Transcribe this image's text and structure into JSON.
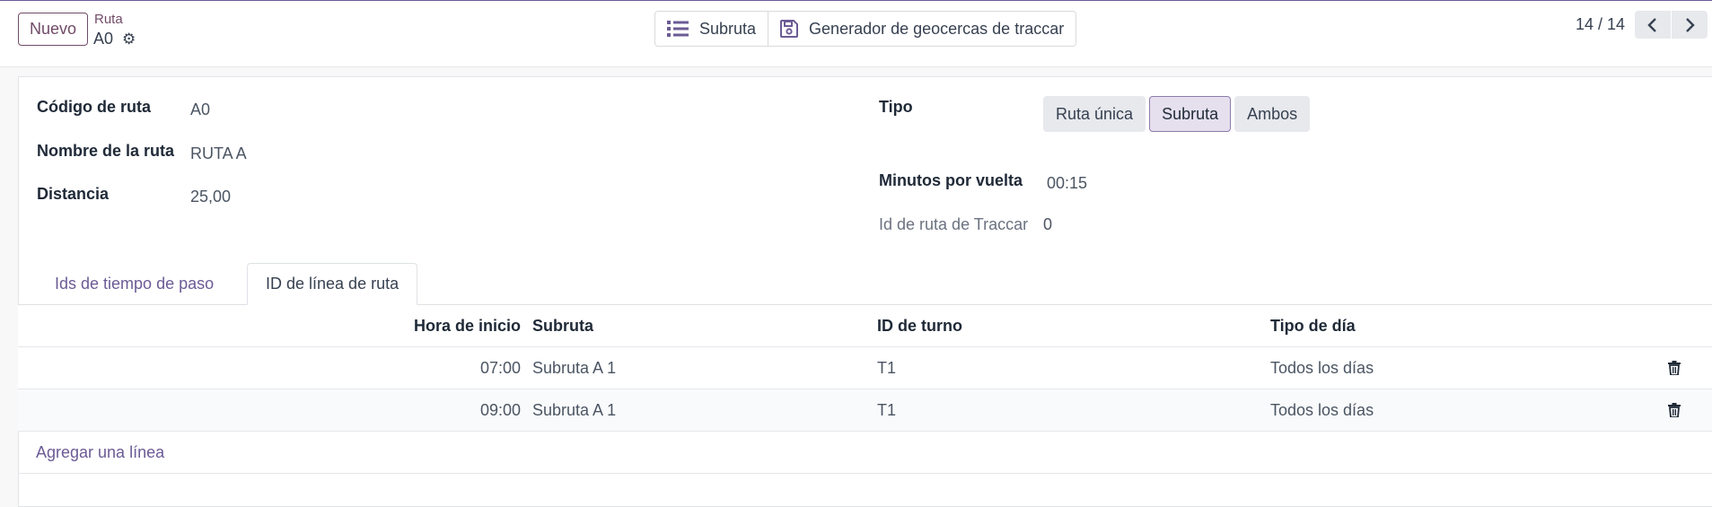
{
  "header": {
    "new_button": "Nuevo",
    "breadcrumb": "Ruta",
    "record_name": "A0",
    "gear_icon": "gear-icon",
    "actions": [
      {
        "label": "Subruta",
        "icon": "list-icon"
      },
      {
        "label": "Generador de geocercas de traccar",
        "icon": "save-icon"
      }
    ],
    "pager": {
      "value": "14 / 14",
      "prev_icon": "chevron-left-icon",
      "next_icon": "chevron-right-icon"
    }
  },
  "form": {
    "codigo_label": "Código de ruta",
    "codigo_value": "A0",
    "nombre_label": "Nombre de la ruta",
    "nombre_value": "RUTA A",
    "distancia_label": "Distancia",
    "distancia_value": "25,00",
    "tipo_label": "Tipo",
    "tipo_options": [
      "Ruta única",
      "Subruta",
      "Ambos"
    ],
    "tipo_selected": "Subruta",
    "minutos_label": "Minutos por vuelta",
    "minutos_value": "00:15",
    "traccar_label": "Id de ruta de Traccar",
    "traccar_value": "0"
  },
  "tabs": [
    {
      "label": "Ids de tiempo de paso",
      "active": false
    },
    {
      "label": "ID de línea de ruta",
      "active": true
    }
  ],
  "table": {
    "columns": [
      "Hora de inicio",
      "Subruta",
      "ID de turno",
      "Tipo de día"
    ],
    "rows": [
      {
        "hora": "07:00",
        "subruta": "Subruta A 1",
        "turno": "T1",
        "tipo": "Todos los días"
      },
      {
        "hora": "09:00",
        "subruta": "Subruta A 1",
        "turno": "T1",
        "tipo": "Todos los días"
      }
    ],
    "add_line": "Agregar una línea",
    "delete_icon": "trash-icon"
  },
  "colors": {
    "primary": "#714b67",
    "accent_active": "#e6e0ee",
    "muted_link": "#6b5b95"
  }
}
